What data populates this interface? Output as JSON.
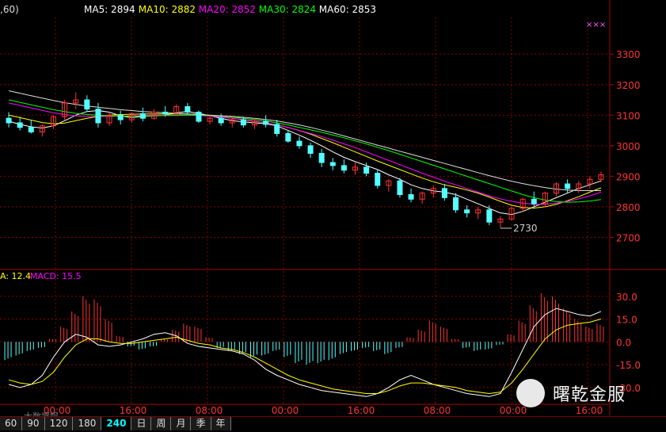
{
  "header": {
    "params": ",60)",
    "ma": [
      {
        "label": "MA5:",
        "value": "2894",
        "color": "#ffffff"
      },
      {
        "label": "MA10:",
        "value": "2882",
        "color": "#ffff00"
      },
      {
        "label": "MA20:",
        "value": "2852",
        "color": "#ff00ff"
      },
      {
        "label": "MA30:",
        "value": "2824",
        "color": "#00ff00"
      },
      {
        "label": "MA60:",
        "value": "2853",
        "color": "#ffffff"
      }
    ]
  },
  "corner_mark": "×××",
  "macd_header": {
    "dea_label": "A:",
    "dea_value": "12.4",
    "dea_color": "#ffff00",
    "macd_label": "MACD:",
    "macd_value": "15.5",
    "macd_color": "#ff00ff"
  },
  "price_axis": {
    "min": 2600,
    "max": 3420,
    "ticks": [
      "3300",
      "3200",
      "3100",
      "3000",
      "2900",
      "2800",
      "2700"
    ],
    "color": "#ff3333"
  },
  "macd_axis": {
    "min": -40,
    "max": 45,
    "ticks": [
      "30.0",
      "15.0",
      "0.0",
      "-15.0",
      "-30.0"
    ]
  },
  "low_marker": "2730",
  "time_labels": [
    "00:00",
    "16:00",
    "08:00",
    "00:00",
    "16:00",
    "08:00",
    "00:00",
    "16:00"
  ],
  "tabs": [
    "60",
    "90",
    "120",
    "180",
    "240",
    "日",
    "周",
    "月",
    "季",
    "年"
  ],
  "active_tab": "240",
  "watermark": {
    "text": "曙乾金服",
    "left_text": "大数据娱"
  },
  "colors": {
    "up": "#ff3232",
    "down": "#54ffff",
    "grid": "#880000",
    "axis": "#aa0000"
  },
  "chart_data": {
    "type": "candlestick",
    "candles": [
      [
        3090,
        3110,
        3060,
        3075
      ],
      [
        3075,
        3095,
        3050,
        3060
      ],
      [
        3060,
        3085,
        3040,
        3045
      ],
      [
        3045,
        3070,
        3030,
        3065
      ],
      [
        3065,
        3100,
        3055,
        3095
      ],
      [
        3095,
        3150,
        3085,
        3140
      ],
      [
        3140,
        3175,
        3120,
        3150
      ],
      [
        3150,
        3165,
        3110,
        3120
      ],
      [
        3120,
        3140,
        3060,
        3075
      ],
      [
        3075,
        3110,
        3065,
        3100
      ],
      [
        3100,
        3115,
        3070,
        3085
      ],
      [
        3085,
        3110,
        3075,
        3105
      ],
      [
        3105,
        3125,
        3080,
        3090
      ],
      [
        3090,
        3120,
        3085,
        3110
      ],
      [
        3110,
        3130,
        3095,
        3105
      ],
      [
        3105,
        3135,
        3100,
        3128
      ],
      [
        3128,
        3140,
        3105,
        3110
      ],
      [
        3110,
        3115,
        3075,
        3080
      ],
      [
        3080,
        3100,
        3070,
        3090
      ],
      [
        3090,
        3105,
        3065,
        3075
      ],
      [
        3075,
        3095,
        3060,
        3085
      ],
      [
        3085,
        3095,
        3060,
        3068
      ],
      [
        3068,
        3090,
        3055,
        3080
      ],
      [
        3080,
        3100,
        3060,
        3070
      ],
      [
        3070,
        3085,
        3030,
        3040
      ],
      [
        3040,
        3050,
        3010,
        3015
      ],
      [
        3015,
        3030,
        2990,
        3000
      ],
      [
        3000,
        3010,
        2960,
        2975
      ],
      [
        2975,
        2990,
        2930,
        2945
      ],
      [
        2945,
        2960,
        2920,
        2935
      ],
      [
        2935,
        2955,
        2910,
        2920
      ],
      [
        2920,
        2945,
        2905,
        2930
      ],
      [
        2930,
        2945,
        2900,
        2910
      ],
      [
        2910,
        2920,
        2860,
        2870
      ],
      [
        2870,
        2890,
        2850,
        2885
      ],
      [
        2885,
        2895,
        2830,
        2840
      ],
      [
        2840,
        2860,
        2815,
        2825
      ],
      [
        2825,
        2850,
        2810,
        2845
      ],
      [
        2845,
        2870,
        2830,
        2860
      ],
      [
        2860,
        2875,
        2820,
        2830
      ],
      [
        2830,
        2845,
        2780,
        2790
      ],
      [
        2790,
        2805,
        2765,
        2780
      ],
      [
        2780,
        2800,
        2760,
        2790
      ],
      [
        2790,
        2805,
        2740,
        2750
      ],
      [
        2750,
        2770,
        2730,
        2760
      ],
      [
        2760,
        2800,
        2755,
        2795
      ],
      [
        2795,
        2830,
        2785,
        2825
      ],
      [
        2825,
        2850,
        2800,
        2810
      ],
      [
        2810,
        2850,
        2800,
        2845
      ],
      [
        2845,
        2880,
        2835,
        2875
      ],
      [
        2875,
        2890,
        2845,
        2860
      ],
      [
        2860,
        2885,
        2845,
        2875
      ],
      [
        2875,
        2900,
        2860,
        2890
      ],
      [
        2890,
        2915,
        2880,
        2905
      ]
    ],
    "macd_hist": [
      -12,
      -9,
      -6,
      -4,
      2,
      10,
      20,
      30,
      28,
      15,
      4,
      -3,
      -5,
      -3,
      2,
      8,
      12,
      10,
      3,
      -4,
      -6,
      -8,
      -10,
      -9,
      -6,
      -10,
      -14,
      -15,
      -14,
      -12,
      -8,
      -6,
      -4,
      -6,
      -8,
      -4,
      3,
      8,
      14,
      10,
      2,
      -4,
      -6,
      -5,
      -2,
      5,
      14,
      24,
      32,
      30,
      22,
      15,
      10,
      12
    ],
    "macd_dif": [
      -28,
      -30,
      -28,
      -22,
      -10,
      0,
      5,
      3,
      -2,
      -3,
      -2,
      0,
      2,
      5,
      6,
      4,
      -1,
      -3,
      -4,
      -5,
      -6,
      -8,
      -12,
      -18,
      -22,
      -25,
      -28,
      -30,
      -32,
      -33,
      -34,
      -35,
      -36,
      -34,
      -30,
      -25,
      -22,
      -25,
      -28,
      -30,
      -32,
      -34,
      -35,
      -36,
      -34,
      -20,
      -5,
      10,
      18,
      22,
      20,
      18,
      17,
      20
    ],
    "macd_dea": [
      -25,
      -27,
      -28,
      -26,
      -20,
      -10,
      -2,
      2,
      2,
      0,
      -1,
      -1,
      0,
      1,
      2,
      3,
      1,
      -1,
      -2,
      -4,
      -5,
      -7,
      -10,
      -14,
      -18,
      -22,
      -25,
      -27,
      -29,
      -31,
      -32,
      -33,
      -34,
      -34,
      -32,
      -29,
      -27,
      -27,
      -28,
      -29,
      -30,
      -32,
      -33,
      -34,
      -33,
      -27,
      -18,
      -8,
      2,
      8,
      11,
      12,
      13,
      15
    ],
    "ma": {
      "ma5": {
        "color": "#ffffff",
        "values": [
          3080,
          3070,
          3062,
          3058,
          3065,
          3082,
          3100,
          3112,
          3115,
          3110,
          3098,
          3092,
          3096,
          3098,
          3100,
          3108,
          3112,
          3106,
          3098,
          3090,
          3082,
          3078,
          3075,
          3072,
          3065,
          3050,
          3035,
          3018,
          3000,
          2980,
          2962,
          2948,
          2935,
          2922,
          2905,
          2890,
          2872,
          2860,
          2852,
          2848,
          2840,
          2825,
          2810,
          2795,
          2780,
          2775,
          2785,
          2800,
          2815,
          2830,
          2845,
          2860,
          2872,
          2885
        ]
      },
      "ma10": {
        "color": "#ffff00",
        "values": [
          3100,
          3092,
          3084,
          3076,
          3072,
          3074,
          3082,
          3090,
          3096,
          3100,
          3102,
          3103,
          3104,
          3104,
          3104,
          3104,
          3104,
          3102,
          3098,
          3094,
          3090,
          3085,
          3080,
          3075,
          3068,
          3060,
          3050,
          3038,
          3024,
          3010,
          2995,
          2980,
          2965,
          2950,
          2936,
          2922,
          2908,
          2894,
          2882,
          2872,
          2864,
          2855,
          2845,
          2832,
          2818,
          2805,
          2798,
          2796,
          2800,
          2808,
          2820,
          2833,
          2848,
          2862
        ]
      },
      "ma20": {
        "color": "#ff00ff",
        "values": [
          3140,
          3132,
          3124,
          3116,
          3108,
          3102,
          3098,
          3096,
          3096,
          3096,
          3097,
          3098,
          3099,
          3100,
          3100,
          3100,
          3100,
          3099,
          3097,
          3094,
          3090,
          3086,
          3081,
          3075,
          3068,
          3060,
          3050,
          3040,
          3030,
          3018,
          3006,
          2994,
          2980,
          2966,
          2952,
          2938,
          2924,
          2910,
          2897,
          2884,
          2872,
          2860,
          2848,
          2836,
          2826,
          2818,
          2812,
          2808,
          2808,
          2812,
          2818,
          2826,
          2836,
          2848
        ]
      },
      "ma30": {
        "color": "#00ff00",
        "values": [
          3150,
          3142,
          3134,
          3126,
          3118,
          3112,
          3106,
          3102,
          3100,
          3098,
          3097,
          3097,
          3097,
          3098,
          3099,
          3099,
          3100,
          3100,
          3099,
          3097,
          3094,
          3090,
          3086,
          3081,
          3075,
          3068,
          3060,
          3052,
          3044,
          3035,
          3026,
          3016,
          3006,
          2995,
          2984,
          2972,
          2960,
          2948,
          2936,
          2924,
          2912,
          2900,
          2888,
          2876,
          2864,
          2852,
          2840,
          2830,
          2822,
          2817,
          2815,
          2816,
          2819,
          2824
        ]
      },
      "ma60": {
        "color": "#dddddd",
        "values": [
          3180,
          3172,
          3164,
          3156,
          3148,
          3141,
          3135,
          3130,
          3126,
          3122,
          3118,
          3115,
          3112,
          3110,
          3108,
          3106,
          3104,
          3102,
          3100,
          3098,
          3096,
          3093,
          3090,
          3086,
          3081,
          3075,
          3068,
          3060,
          3051,
          3042,
          3032,
          3022,
          3012,
          3002,
          2992,
          2982,
          2972,
          2962,
          2952,
          2942,
          2932,
          2922,
          2912,
          2902,
          2893,
          2884,
          2876,
          2869,
          2863,
          2858,
          2855,
          2853,
          2853,
          2853
        ]
      }
    }
  }
}
